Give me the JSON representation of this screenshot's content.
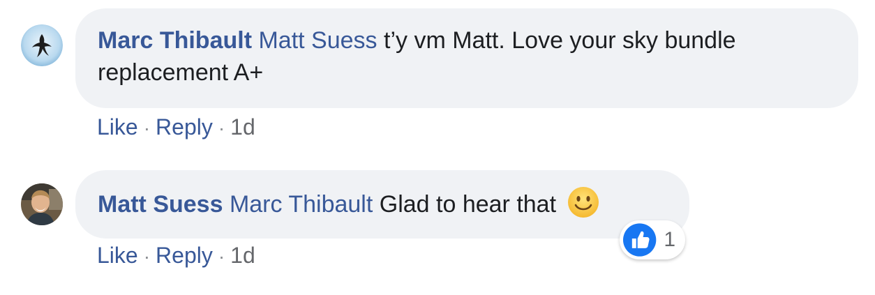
{
  "comments": [
    {
      "author": "Marc Thibault",
      "mention": "Matt Suess",
      "text": "t’y vm Matt. Love your sky bundle replacement A+",
      "avatar": "bird-silhouette-avatar",
      "actions": {
        "like": "Like",
        "reply": "Reply",
        "time": "1d"
      }
    },
    {
      "author": "Matt Suess",
      "mention": "Marc Thibault",
      "text": "Glad to hear that",
      "emoji": "slightly-smiling-face",
      "avatar": "person-photo-avatar",
      "actions": {
        "like": "Like",
        "reply": "Reply",
        "time": "1d"
      },
      "reaction": {
        "type": "like-icon",
        "count": "1"
      }
    }
  ],
  "separator": "·",
  "colors": {
    "link": "#385898",
    "bubble": "#f0f2f5",
    "text": "#1c1e21",
    "like_blue": "#1877f2"
  }
}
